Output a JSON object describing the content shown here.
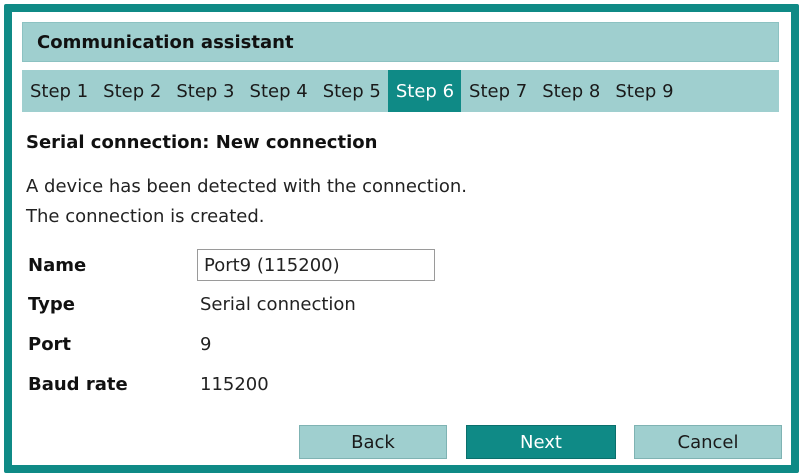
{
  "window": {
    "title": "Communication assistant"
  },
  "steps": [
    {
      "label": "Step 1",
      "active": false
    },
    {
      "label": "Step 2",
      "active": false
    },
    {
      "label": "Step 3",
      "active": false
    },
    {
      "label": "Step 4",
      "active": false
    },
    {
      "label": "Step 5",
      "active": false
    },
    {
      "label": "Step 6",
      "active": true
    },
    {
      "label": "Step 7",
      "active": false
    },
    {
      "label": "Step 8",
      "active": false
    },
    {
      "label": "Step 9",
      "active": false
    }
  ],
  "content": {
    "section_title": "Serial connection: New connection",
    "description_line1": "A device has been detected with the connection.",
    "description_line2": "The connection is created."
  },
  "fields": {
    "name_label": "Name",
    "name_value": "Port9 (115200)",
    "type_label": "Type",
    "type_value": "Serial connection",
    "port_label": "Port",
    "port_value": "9",
    "baud_label": "Baud rate",
    "baud_value": "115200"
  },
  "buttons": {
    "back": "Back",
    "next": "Next",
    "cancel": "Cancel"
  },
  "colors": {
    "accent": "#0f8a86",
    "bar": "#9fcfcf"
  }
}
